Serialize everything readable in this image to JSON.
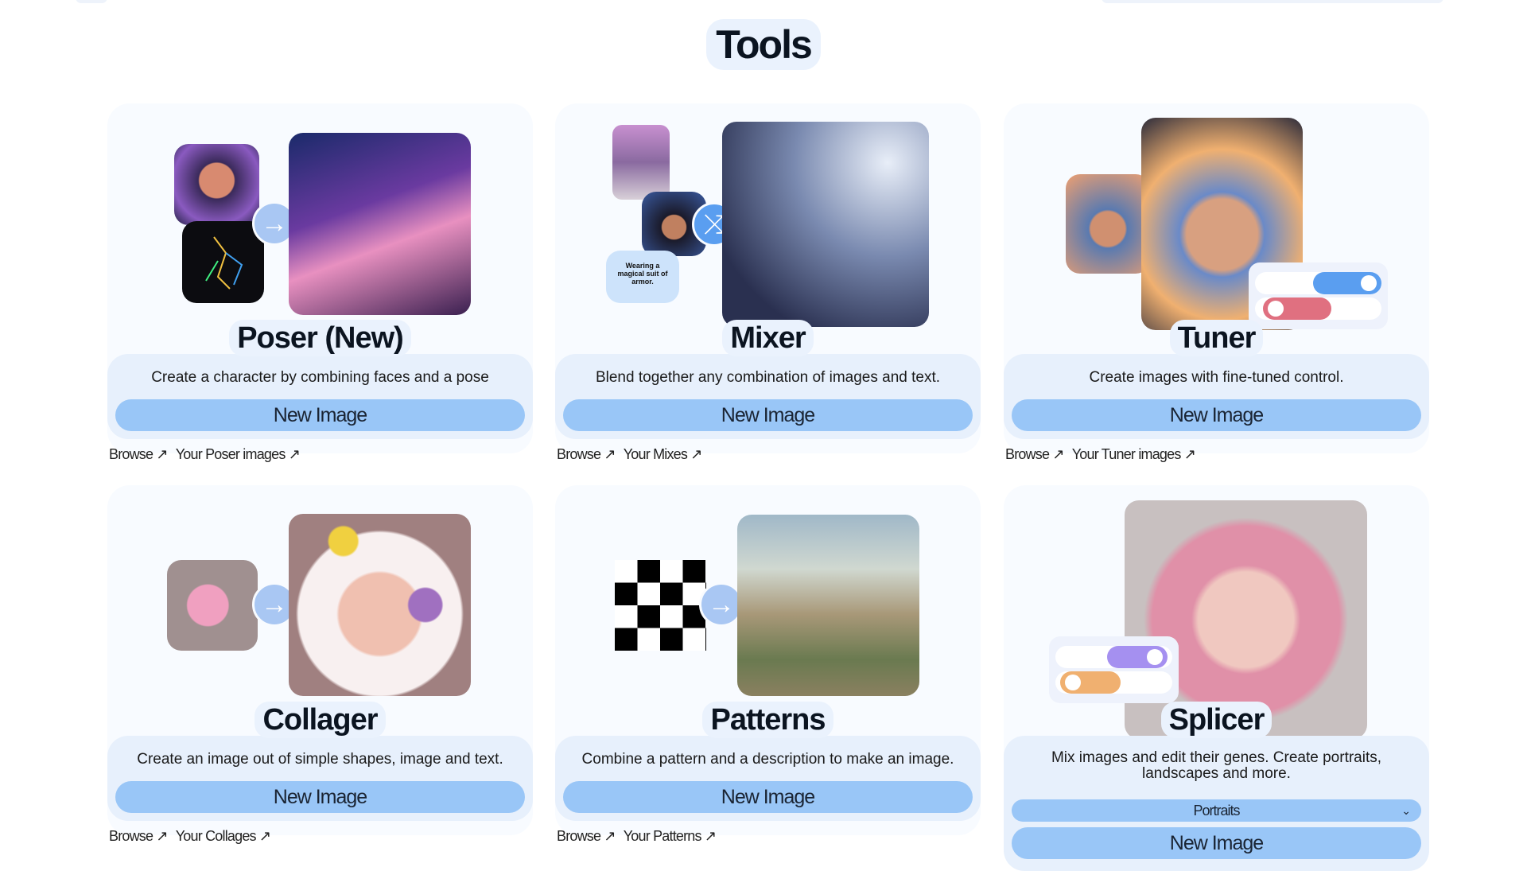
{
  "page": {
    "title": "Tools"
  },
  "tools": [
    {
      "name": "Poser (New)",
      "description": "Create a character by combining faces and a pose",
      "button": "New Image",
      "links": [
        "Browse ↗",
        "Your Poser images ↗"
      ]
    },
    {
      "name": "Mixer",
      "description": "Blend together any combination of images and text.",
      "button": "New Image",
      "links": [
        "Browse ↗",
        "Your Mixes ↗"
      ],
      "prompt_text": "Wearing a magical suit of armor."
    },
    {
      "name": "Tuner",
      "description": "Create images with fine-tuned control.",
      "button": "New Image",
      "links": [
        "Browse ↗",
        "Your Tuner images ↗"
      ]
    },
    {
      "name": "Collager",
      "description": "Create an image out of simple shapes, image and text.",
      "button": "New Image",
      "links": [
        "Browse ↗",
        "Your Collages ↗"
      ]
    },
    {
      "name": "Patterns",
      "description": "Combine a pattern and a description to make an image.",
      "button": "New Image",
      "links": [
        "Browse ↗",
        "Your Patterns ↗"
      ]
    },
    {
      "name": "Splicer",
      "description": "Mix images and edit their genes. Create portraits, landscapes and more.",
      "button": "New Image",
      "select": {
        "value": "Portraits"
      }
    }
  ],
  "colors": {
    "button": "#99c6f7",
    "panel": "#e7f0fc",
    "toggle_blue": "#5a9ef0",
    "toggle_red": "#e07080",
    "toggle_purple": "#a590f0",
    "toggle_orange": "#f0b070"
  },
  "icons": {
    "arrow": "arrow-right-icon",
    "shuffle": "shuffle-icon",
    "dropdown": "chevron-down-icon"
  }
}
